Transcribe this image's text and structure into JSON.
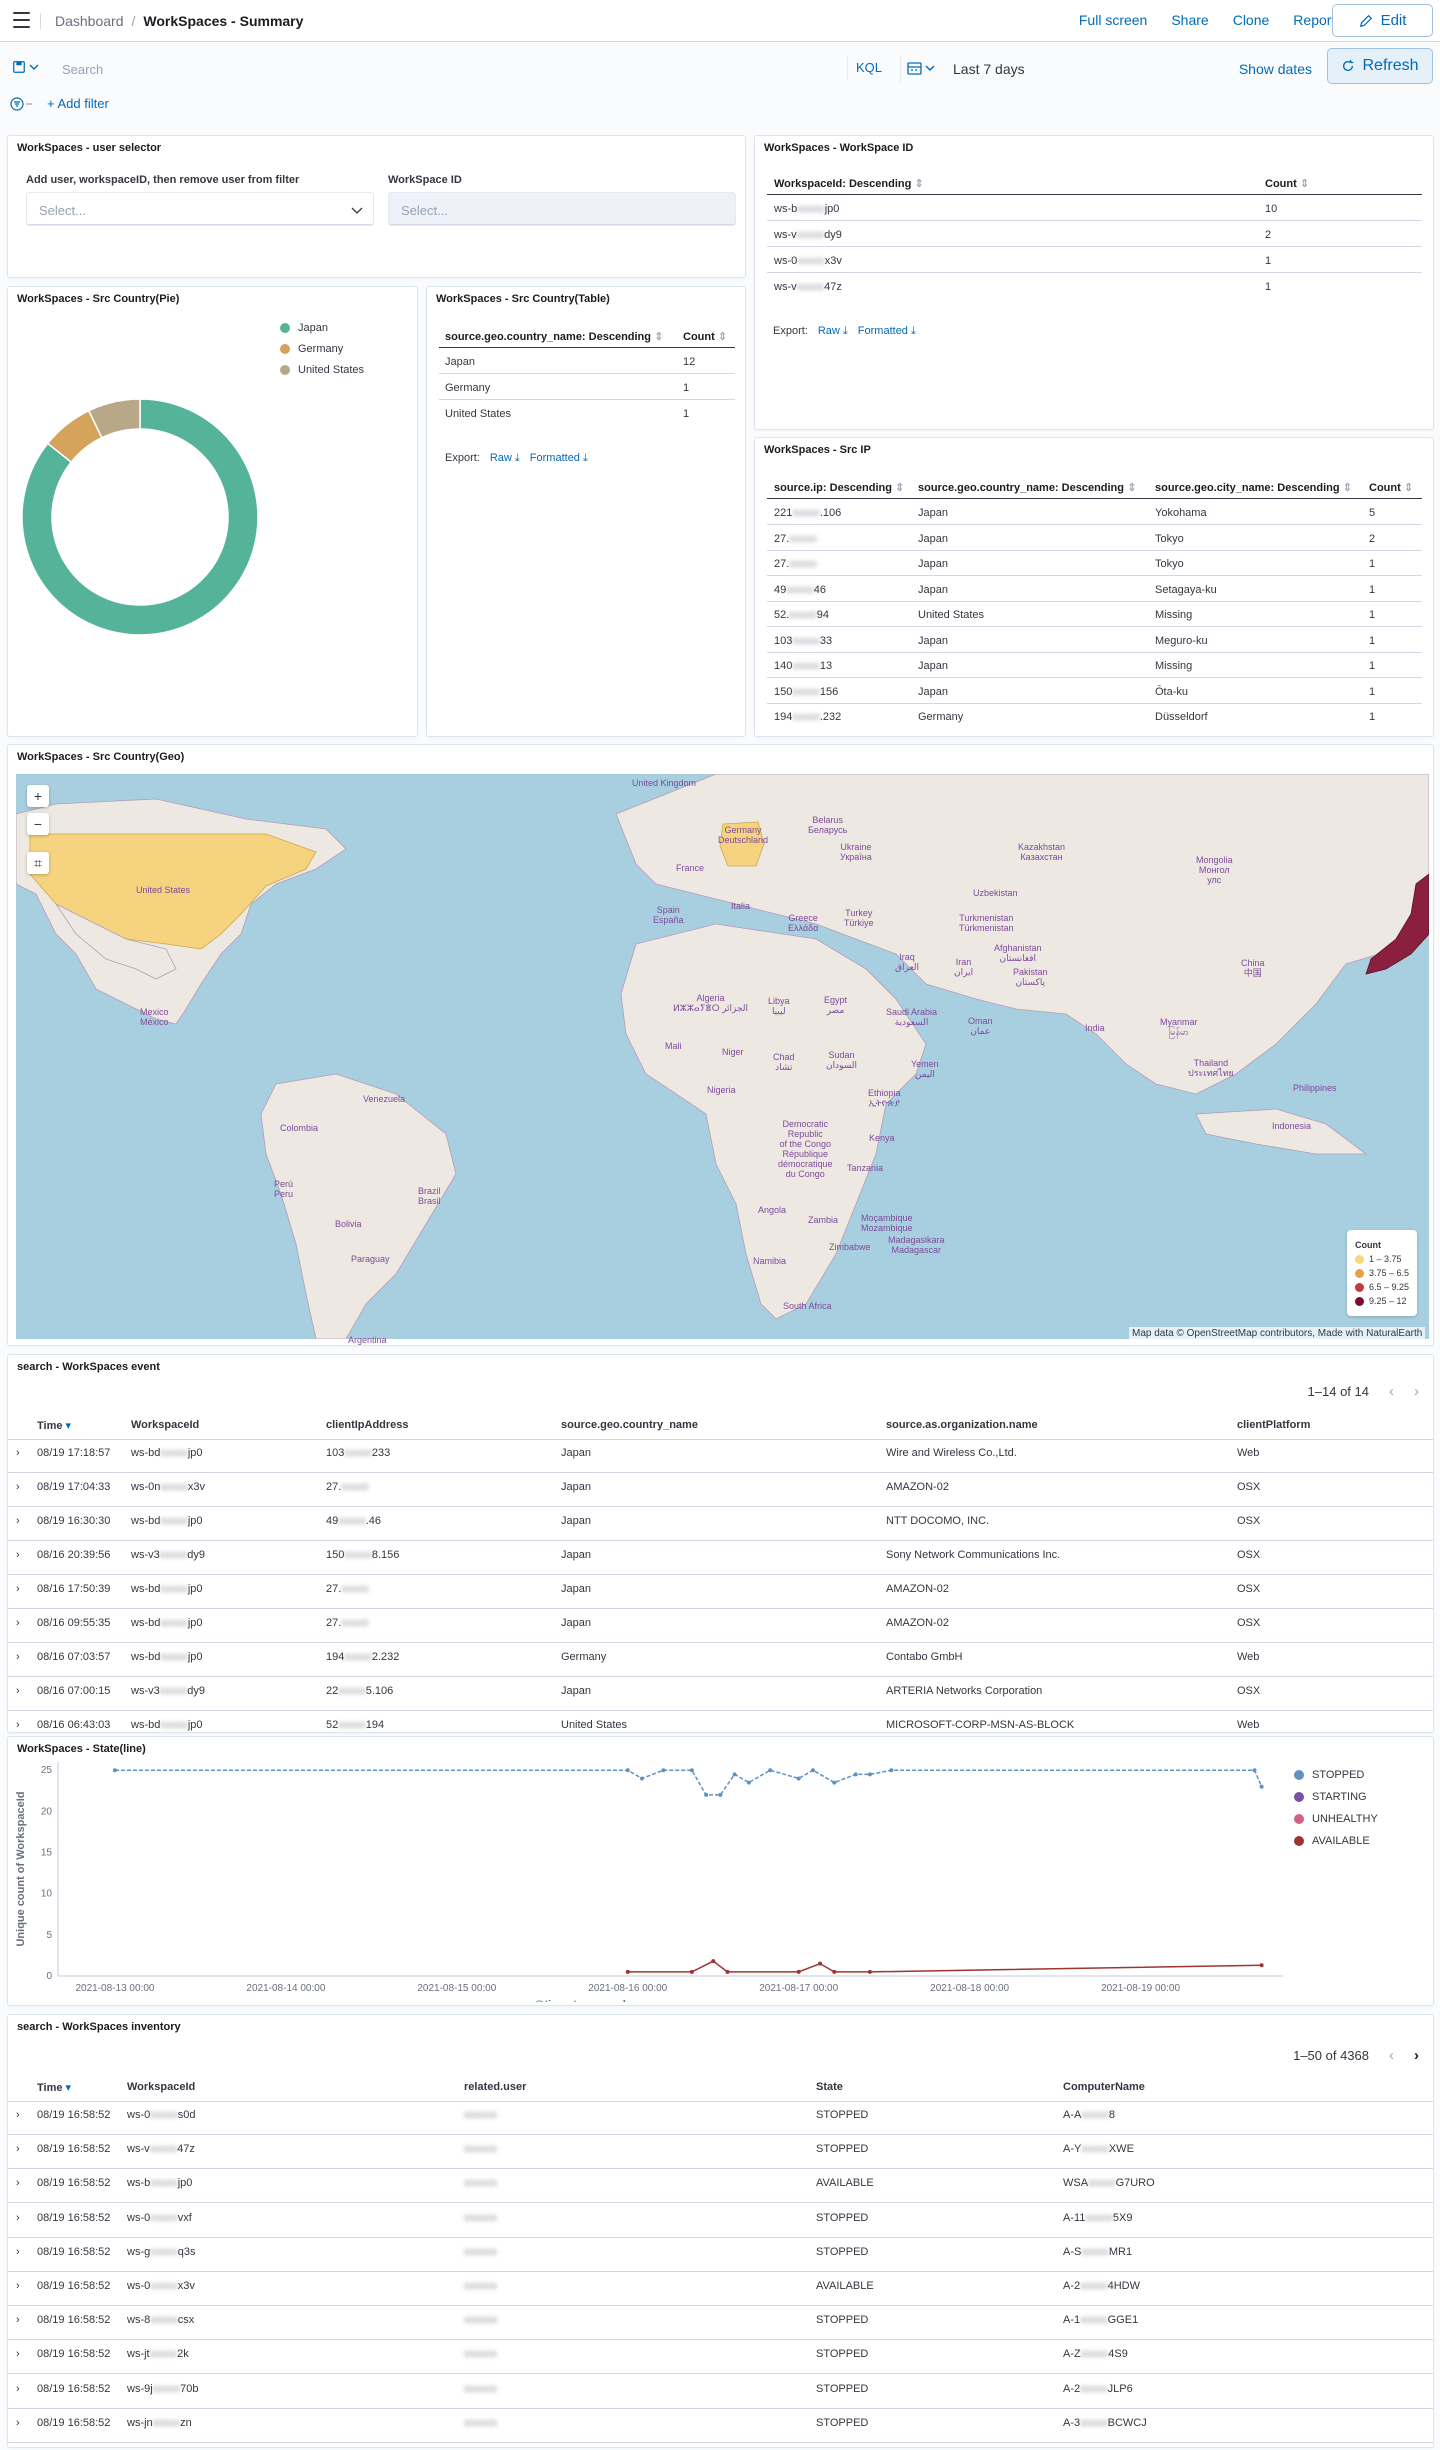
{
  "breadcrumb": {
    "parent": "Dashboard",
    "current": "WorkSpaces - Summary"
  },
  "top_links": [
    "Full screen",
    "Share",
    "Clone",
    "Reporting"
  ],
  "edit_label": "Edit",
  "query": {
    "placeholder": "Search",
    "language": "KQL",
    "time_range": "Last 7 days",
    "show_dates": "Show dates",
    "refresh": "Refresh",
    "add_filter": "+ Add filter"
  },
  "user_selector": {
    "title": "WorkSpaces - user selector",
    "user_label": "Add user, workspaceID, then remove user from filter",
    "user_placeholder": "Select...",
    "ws_label": "WorkSpace ID",
    "ws_placeholder": "Select..."
  },
  "ws_id_panel": {
    "title": "WorkSpaces - WorkSpace ID",
    "headers": [
      "WorkspaceId: Descending",
      "Count"
    ],
    "rows": [
      {
        "a": "ws-b",
        "b": "jp0",
        "count": "10"
      },
      {
        "a": "ws-v",
        "b": "dy9",
        "count": "2"
      },
      {
        "a": "ws-0",
        "b": "x3v",
        "count": "1"
      },
      {
        "a": "ws-v",
        "b": "47z",
        "count": "1"
      }
    ],
    "export": "Export:",
    "raw": "Raw",
    "formatted": "Formatted"
  },
  "pie_panel": {
    "title": "WorkSpaces - Src Country(Pie)",
    "legend": [
      {
        "name": "Japan",
        "color": "#54b399"
      },
      {
        "name": "Germany",
        "color": "#d6a35c"
      },
      {
        "name": "United States",
        "color": "#b9a888"
      }
    ]
  },
  "chart_data": [
    {
      "type": "pie",
      "donut": true,
      "categories": [
        "Japan",
        "Germany",
        "United States"
      ],
      "values": [
        12,
        1,
        1
      ],
      "colors": [
        "#54b399",
        "#d6a35c",
        "#b9a888"
      ],
      "legend": "top-right"
    },
    {
      "type": "line",
      "xlabel": "@timestamp per hour",
      "ylabel": "Unique count of WorkspaceId",
      "ylim": [
        0,
        26
      ],
      "yticks": [
        0,
        5,
        10,
        15,
        20,
        25
      ],
      "xticks": [
        "2021-08-13 00:00",
        "2021-08-14 00:00",
        "2021-08-15 00:00",
        "2021-08-16 00:00",
        "2021-08-17 00:00",
        "2021-08-18 00:00",
        "2021-08-19 00:00"
      ],
      "legend": "right",
      "series": [
        {
          "name": "STOPPED",
          "color": "#6092c0",
          "points": [
            [
              "2021-08-13 00:00",
              25
            ],
            [
              "2021-08-16 00:00",
              25
            ],
            [
              "2021-08-16 02:00",
              24
            ],
            [
              "2021-08-16 05:00",
              25
            ],
            [
              "2021-08-16 09:00",
              25
            ],
            [
              "2021-08-16 11:00",
              22
            ],
            [
              "2021-08-16 13:00",
              22
            ],
            [
              "2021-08-16 15:00",
              24.5
            ],
            [
              "2021-08-16 17:00",
              23.5
            ],
            [
              "2021-08-16 20:00",
              25
            ],
            [
              "2021-08-17 00:00",
              24
            ],
            [
              "2021-08-17 02:00",
              25
            ],
            [
              "2021-08-17 05:00",
              23.5
            ],
            [
              "2021-08-17 08:00",
              24.5
            ],
            [
              "2021-08-17 10:00",
              24.5
            ],
            [
              "2021-08-17 13:00",
              25
            ],
            [
              "2021-08-19 16:00",
              25
            ],
            [
              "2021-08-19 17:00",
              23
            ]
          ]
        },
        {
          "name": "STARTING",
          "color": "#7b4fa3",
          "points": []
        },
        {
          "name": "UNHEALTHY",
          "color": "#d36086",
          "points": []
        },
        {
          "name": "AVAILABLE",
          "color": "#9e3533",
          "points": [
            [
              "2021-08-16 00:00",
              0.5
            ],
            [
              "2021-08-16 09:00",
              0.5
            ],
            [
              "2021-08-16 12:00",
              1.8
            ],
            [
              "2021-08-16 14:00",
              0.5
            ],
            [
              "2021-08-17 00:00",
              0.5
            ],
            [
              "2021-08-17 03:00",
              1.5
            ],
            [
              "2021-08-17 05:00",
              0.5
            ],
            [
              "2021-08-17 10:00",
              0.5
            ],
            [
              "2021-08-19 17:00",
              1.3
            ]
          ]
        }
      ]
    }
  ],
  "country_table": {
    "title": "WorkSpaces - Src Country(Table)",
    "headers": [
      "source.geo.country_name: Descending",
      "Count"
    ],
    "rows": [
      [
        "Japan",
        "12"
      ],
      [
        "Germany",
        "1"
      ],
      [
        "United States",
        "1"
      ]
    ],
    "export": "Export:",
    "raw": "Raw",
    "formatted": "Formatted"
  },
  "src_ip": {
    "title": "WorkSpaces - Src IP",
    "headers": [
      "source.ip: Descending",
      "source.geo.country_name: Descending",
      "source.geo.city_name: Descending",
      "Count"
    ],
    "rows": [
      {
        "a": "221",
        "b": ".106",
        "country": "Japan",
        "city": "Yokohama",
        "count": "5"
      },
      {
        "a": "27.",
        "b": "",
        "country": "Japan",
        "city": "Tokyo",
        "count": "2"
      },
      {
        "a": "27.",
        "b": "",
        "country": "Japan",
        "city": "Tokyo",
        "count": "1"
      },
      {
        "a": "49",
        "b": "46",
        "country": "Japan",
        "city": "Setagaya-ku",
        "count": "1"
      },
      {
        "a": "52.",
        "b": "94",
        "country": "United States",
        "city": "Missing",
        "count": "1"
      },
      {
        "a": "103",
        "b": "33",
        "country": "Japan",
        "city": "Meguro-ku",
        "count": "1"
      },
      {
        "a": "140",
        "b": "13",
        "country": "Japan",
        "city": "Missing",
        "count": "1"
      },
      {
        "a": "150",
        "b": "156",
        "country": "Japan",
        "city": "Ōta-ku",
        "count": "1"
      },
      {
        "a": "194",
        "b": ".232",
        "country": "Germany",
        "city": "Düsseldorf",
        "count": "1"
      }
    ]
  },
  "geo": {
    "title": "WorkSpaces - Src Country(Geo)",
    "legend_title": "Count",
    "legend": [
      {
        "label": "1 – 3.75",
        "color": "#f5d97a"
      },
      {
        "label": "3.75 – 6.5",
        "color": "#e8a04a"
      },
      {
        "label": "6.5 – 9.25",
        "color": "#c53b3b"
      },
      {
        "label": "9.25 – 12",
        "color": "#7a0e2f"
      }
    ],
    "attribution": "Map data © OpenStreetMap contributors, Made with NaturalEarth",
    "labels": {
      "uk": "United Kingdom",
      "belarus": "Belarus\nБеларусь",
      "ukraine": "Ukraine\nУкраїна",
      "kazakhstan": "Kazakhstan\nКазахстан",
      "mongolia": "Mongolia\nМонгол\nулс",
      "france": "France",
      "spain": "Spain\nEspaña",
      "italy": "Italia",
      "turkey": "Turkey\nTürkiye",
      "turkmenistan": "Turkmenistan\nTürkmenistan",
      "uzbekistan": "Uzbekistan",
      "china": "China\n中国",
      "greece": "Greece\nΕλλάδα",
      "iraq": "Iraq\nالعراق",
      "iran": "Iran\nايران",
      "afghanistan": "Afghanistan\nافغانستان",
      "pakistan": "Pakistan\nپاکستان",
      "usa": "United States",
      "mexico": "Mexico\nMéxico",
      "algeria": "Algeria\nⵍⵣⵣⴰⵢⴻⵔ الجزائر",
      "libya": "Libya\nليبيا",
      "egypt": "Egypt\nمصر",
      "saudi": "Saudi Arabia\nالسعودية",
      "oman": "Oman\nعمان",
      "india": "India",
      "myanmar": "Myanmar\nမြန်မာ",
      "thailand": "Thailand\nประเทศไทย",
      "philippines": "Philippines",
      "yemen": "Yemen\nاليمن",
      "mali": "Mali",
      "niger": "Niger",
      "chad": "Chad\nتشاد",
      "sudan": "Sudan\nالسودان",
      "nigeria": "Nigeria",
      "ethiopia": "Ethiopia\nኢትዮጵያ",
      "venezuela": "Venezuela",
      "colombia": "Colombia",
      "drc": "Democratic\nRepublic\nof the Congo\nRépublique\ndémocratique\ndu Congo",
      "kenya": "Kenya",
      "tanzania": "Tanzania",
      "peru": "Perú\nPeru",
      "brazil": "Brazil\nBrasil",
      "bolivia": "Bolivia",
      "angola": "Angola",
      "zambia": "Zambia",
      "mozambique": "Moçambique\nMozambique",
      "zimbabwe": "Zimbabwe",
      "madagascar": "Madagasikara\nMadagascar",
      "namibia": "Namibia",
      "southafrica": "South Africa",
      "paraguay": "Paraguay",
      "argentina": "Argentina",
      "indonesia": "Indonesia",
      "germany": "Germany\nDeutschland"
    }
  },
  "events": {
    "title": "search - WorkSpaces event",
    "pager": "1–14 of 14",
    "headers": [
      "Time",
      "WorkspaceId",
      "clientIpAddress",
      "source.geo.country_name",
      "source.as.organization.name",
      "clientPlatform"
    ],
    "rows": [
      {
        "time": "08/19 17:18:57",
        "ws_a": "ws-bd",
        "ws_b": "jp0",
        "ip_a": "103",
        "ip_b": "233",
        "country": "Japan",
        "org": "Wire and Wireless Co.,Ltd.",
        "platform": "Web"
      },
      {
        "time": "08/19 17:04:33",
        "ws_a": "ws-0n",
        "ws_b": "x3v",
        "ip_a": "27.",
        "ip_b": "",
        "country": "Japan",
        "org": "AMAZON-02",
        "platform": "OSX"
      },
      {
        "time": "08/19 16:30:30",
        "ws_a": "ws-bd",
        "ws_b": "jp0",
        "ip_a": "49",
        "ip_b": ".46",
        "country": "Japan",
        "org": "NTT DOCOMO, INC.",
        "platform": "OSX"
      },
      {
        "time": "08/16 20:39:56",
        "ws_a": "ws-v3",
        "ws_b": "dy9",
        "ip_a": "150",
        "ip_b": "8.156",
        "country": "Japan",
        "org": "Sony Network Communications Inc.",
        "platform": "OSX"
      },
      {
        "time": "08/16 17:50:39",
        "ws_a": "ws-bd",
        "ws_b": "jp0",
        "ip_a": "27.",
        "ip_b": "",
        "country": "Japan",
        "org": "AMAZON-02",
        "platform": "OSX"
      },
      {
        "time": "08/16 09:55:35",
        "ws_a": "ws-bd",
        "ws_b": "jp0",
        "ip_a": "27.",
        "ip_b": "",
        "country": "Japan",
        "org": "AMAZON-02",
        "platform": "OSX"
      },
      {
        "time": "08/16 07:03:57",
        "ws_a": "ws-bd",
        "ws_b": "jp0",
        "ip_a": "194",
        "ip_b": "2.232",
        "country": "Germany",
        "org": "Contabo GmbH",
        "platform": "Web"
      },
      {
        "time": "08/16 07:00:15",
        "ws_a": "ws-v3",
        "ws_b": "dy9",
        "ip_a": "22",
        "ip_b": "5.106",
        "country": "Japan",
        "org": "ARTERIA Networks Corporation",
        "platform": "OSX"
      },
      {
        "time": "08/16 06:43:03",
        "ws_a": "ws-bd",
        "ws_b": "jp0",
        "ip_a": "52",
        "ip_b": "194",
        "country": "United States",
        "org": "MICROSOFT-CORP-MSN-AS-BLOCK",
        "platform": "Web"
      }
    ]
  },
  "state_line": {
    "title": "WorkSpaces - State(line)"
  },
  "inventory": {
    "title": "search - WorkSpaces inventory",
    "pager": "1–50 of 4368",
    "headers": [
      "Time",
      "WorkspaceId",
      "related.user",
      "State",
      "ComputerName"
    ],
    "rows": [
      {
        "time": "08/19 16:58:52",
        "ws_a": "ws-0",
        "ws_b": "s0d",
        "state": "STOPPED",
        "cn_a": "A-A",
        "cn_b": "8"
      },
      {
        "time": "08/19 16:58:52",
        "ws_a": "ws-v",
        "ws_b": "47z",
        "state": "STOPPED",
        "cn_a": "A-Y",
        "cn_b": "XWE"
      },
      {
        "time": "08/19 16:58:52",
        "ws_a": "ws-b",
        "ws_b": "jp0",
        "state": "AVAILABLE",
        "cn_a": "WSA",
        "cn_b": "G7URO"
      },
      {
        "time": "08/19 16:58:52",
        "ws_a": "ws-0",
        "ws_b": "vxf",
        "state": "STOPPED",
        "cn_a": "A-11",
        "cn_b": "5X9"
      },
      {
        "time": "08/19 16:58:52",
        "ws_a": "ws-g",
        "ws_b": "q3s",
        "state": "STOPPED",
        "cn_a": "A-S",
        "cn_b": "MR1"
      },
      {
        "time": "08/19 16:58:52",
        "ws_a": "ws-0",
        "ws_b": "x3v",
        "state": "AVAILABLE",
        "cn_a": "A-2",
        "cn_b": "4HDW"
      },
      {
        "time": "08/19 16:58:52",
        "ws_a": "ws-8",
        "ws_b": "csx",
        "state": "STOPPED",
        "cn_a": "A-1",
        "cn_b": "GGE1"
      },
      {
        "time": "08/19 16:58:52",
        "ws_a": "ws-jt",
        "ws_b": "2k",
        "state": "STOPPED",
        "cn_a": "A-Z",
        "cn_b": "4S9"
      },
      {
        "time": "08/19 16:58:52",
        "ws_a": "ws-9j",
        "ws_b": "70b",
        "state": "STOPPED",
        "cn_a": "A-2",
        "cn_b": "JLP6"
      },
      {
        "time": "08/19 16:58:52",
        "ws_a": "ws-jn",
        "ws_b": "zn",
        "state": "STOPPED",
        "cn_a": "A-3",
        "cn_b": "BCWCJ"
      }
    ]
  }
}
